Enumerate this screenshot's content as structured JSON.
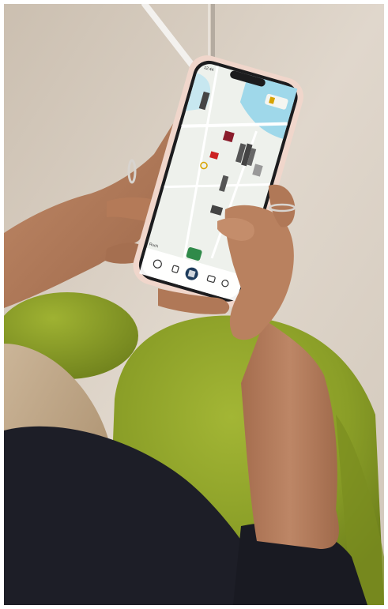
{
  "scene": {
    "description_hidden": "",
    "phone": {
      "status_time": "12:44",
      "bottom_left_label": "Ruch"
    },
    "colors": {
      "background_wall": "#d8cec2",
      "chair_green": "#8ea32a",
      "phone_case": "#f0d6cb",
      "map_water": "#9fd8ea",
      "map_land": "#eef1ec",
      "sleeve": "#1b1c24",
      "skin": "#b57e5d"
    }
  }
}
